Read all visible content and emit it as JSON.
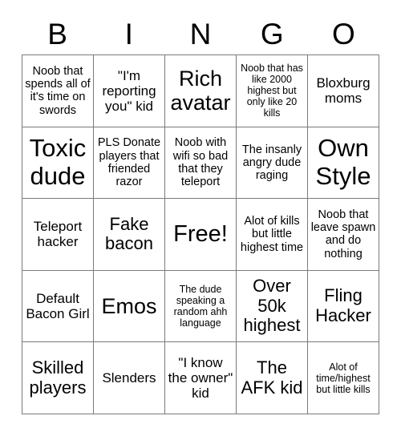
{
  "card": {
    "header_letters": [
      "B",
      "I",
      "N",
      "G",
      "O"
    ],
    "rows": [
      [
        {
          "text": "Noob that spends all of it's time on swords",
          "size": "sz-s"
        },
        {
          "text": "\"I'm reporting you\" kid",
          "size": "sz-m"
        },
        {
          "text": "Rich avatar",
          "size": "sz-xl"
        },
        {
          "text": "Noob that has like 2000 highest but only like 20 kills",
          "size": "sz-xs"
        },
        {
          "text": "Bloxburg moms",
          "size": "sz-m"
        }
      ],
      [
        {
          "text": "Toxic dude",
          "size": "sz-xxl"
        },
        {
          "text": "PLS Donate players that friended razor",
          "size": "sz-s"
        },
        {
          "text": "Noob with wifi so bad that they teleport",
          "size": "sz-s"
        },
        {
          "text": "The insanly angry dude raging",
          "size": "sz-s"
        },
        {
          "text": "Own Style",
          "size": "sz-xxl"
        }
      ],
      [
        {
          "text": "Teleport hacker",
          "size": "sz-m"
        },
        {
          "text": "Fake bacon",
          "size": "sz-l"
        },
        {
          "text": "Free!",
          "size": "sz-free"
        },
        {
          "text": "Alot of kills but little highest time",
          "size": "sz-s"
        },
        {
          "text": "Noob that leave spawn and do nothing",
          "size": "sz-s"
        }
      ],
      [
        {
          "text": "Default Bacon Girl",
          "size": "sz-m"
        },
        {
          "text": "Emos",
          "size": "sz-xl"
        },
        {
          "text": "The dude speaking a random ahh language",
          "size": "sz-xs"
        },
        {
          "text": "Over 50k highest",
          "size": "sz-l"
        },
        {
          "text": "Fling Hacker",
          "size": "sz-l"
        }
      ],
      [
        {
          "text": "Skilled players",
          "size": "sz-l"
        },
        {
          "text": "Slenders",
          "size": "sz-m"
        },
        {
          "text": "\"I know the owner\" kid",
          "size": "sz-m"
        },
        {
          "text": "The AFK kid",
          "size": "sz-l"
        },
        {
          "text": "Alot of time/highest but little kills",
          "size": "sz-xs"
        }
      ]
    ]
  },
  "colors": {
    "background": "#ffffff",
    "grid_line": "#7a7a7a",
    "text": "#000000"
  }
}
